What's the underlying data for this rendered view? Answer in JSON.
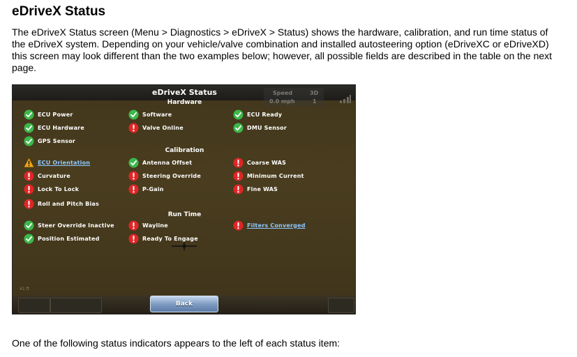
{
  "doc": {
    "title": "eDriveX Status",
    "intro": "The eDriveX Status screen (Menu > Diagnostics > eDriveX > Status) shows the hardware, calibration, and run time status of the eDriveX system. Depending on your vehicle/valve combination and installed autosteering option (eDriveXC or eDriveXD) this screen may look different than the two examples below; however, all possible fields are described in the table on the next page.",
    "footer": "One of the following status indicators appears to the left of each status item:"
  },
  "screen": {
    "title": "eDriveX Status",
    "speed_label": "Speed",
    "speed_value": "0.0 mph",
    "fix_label": "3D",
    "fix_value": "1",
    "scale_label": "41 ft",
    "back_label": "Back",
    "colors": {
      "ok": "#3cb84a",
      "error": "#e02626",
      "warning": "#f2a51a",
      "link": "#8ec8ff"
    },
    "hardware": {
      "title": "Hardware",
      "items": [
        {
          "label": "ECU Power",
          "status": "ok"
        },
        {
          "label": "Software",
          "status": "ok"
        },
        {
          "label": "ECU Ready",
          "status": "ok"
        },
        {
          "label": "ECU Hardware",
          "status": "ok"
        },
        {
          "label": "Valve Online",
          "status": "error"
        },
        {
          "label": "DMU Sensor",
          "status": "ok"
        },
        {
          "label": "GPS Sensor",
          "status": "ok"
        }
      ]
    },
    "calibration": {
      "title": "Calibration",
      "items": [
        {
          "label": "ECU Orientation",
          "status": "warning"
        },
        {
          "label": "Antenna Offset",
          "status": "ok"
        },
        {
          "label": "Coarse WAS",
          "status": "error"
        },
        {
          "label": "Curvature",
          "status": "error"
        },
        {
          "label": "Steering Override",
          "status": "error"
        },
        {
          "label": "Minimum Current",
          "status": "error"
        },
        {
          "label": "Lock To Lock",
          "status": "error"
        },
        {
          "label": "P-Gain",
          "status": "error"
        },
        {
          "label": "Fine WAS",
          "status": "error"
        },
        {
          "label": "Roll and Pitch Bias",
          "status": "error"
        }
      ]
    },
    "runtime": {
      "title": "Run Time",
      "items": [
        {
          "label": "Steer Override Inactive",
          "status": "ok"
        },
        {
          "label": "Wayline",
          "status": "error"
        },
        {
          "label": "Filters Converged",
          "status": "error"
        },
        {
          "label": "Position Estimated",
          "status": "ok"
        },
        {
          "label": "Ready To Engage",
          "status": "error"
        }
      ]
    }
  }
}
